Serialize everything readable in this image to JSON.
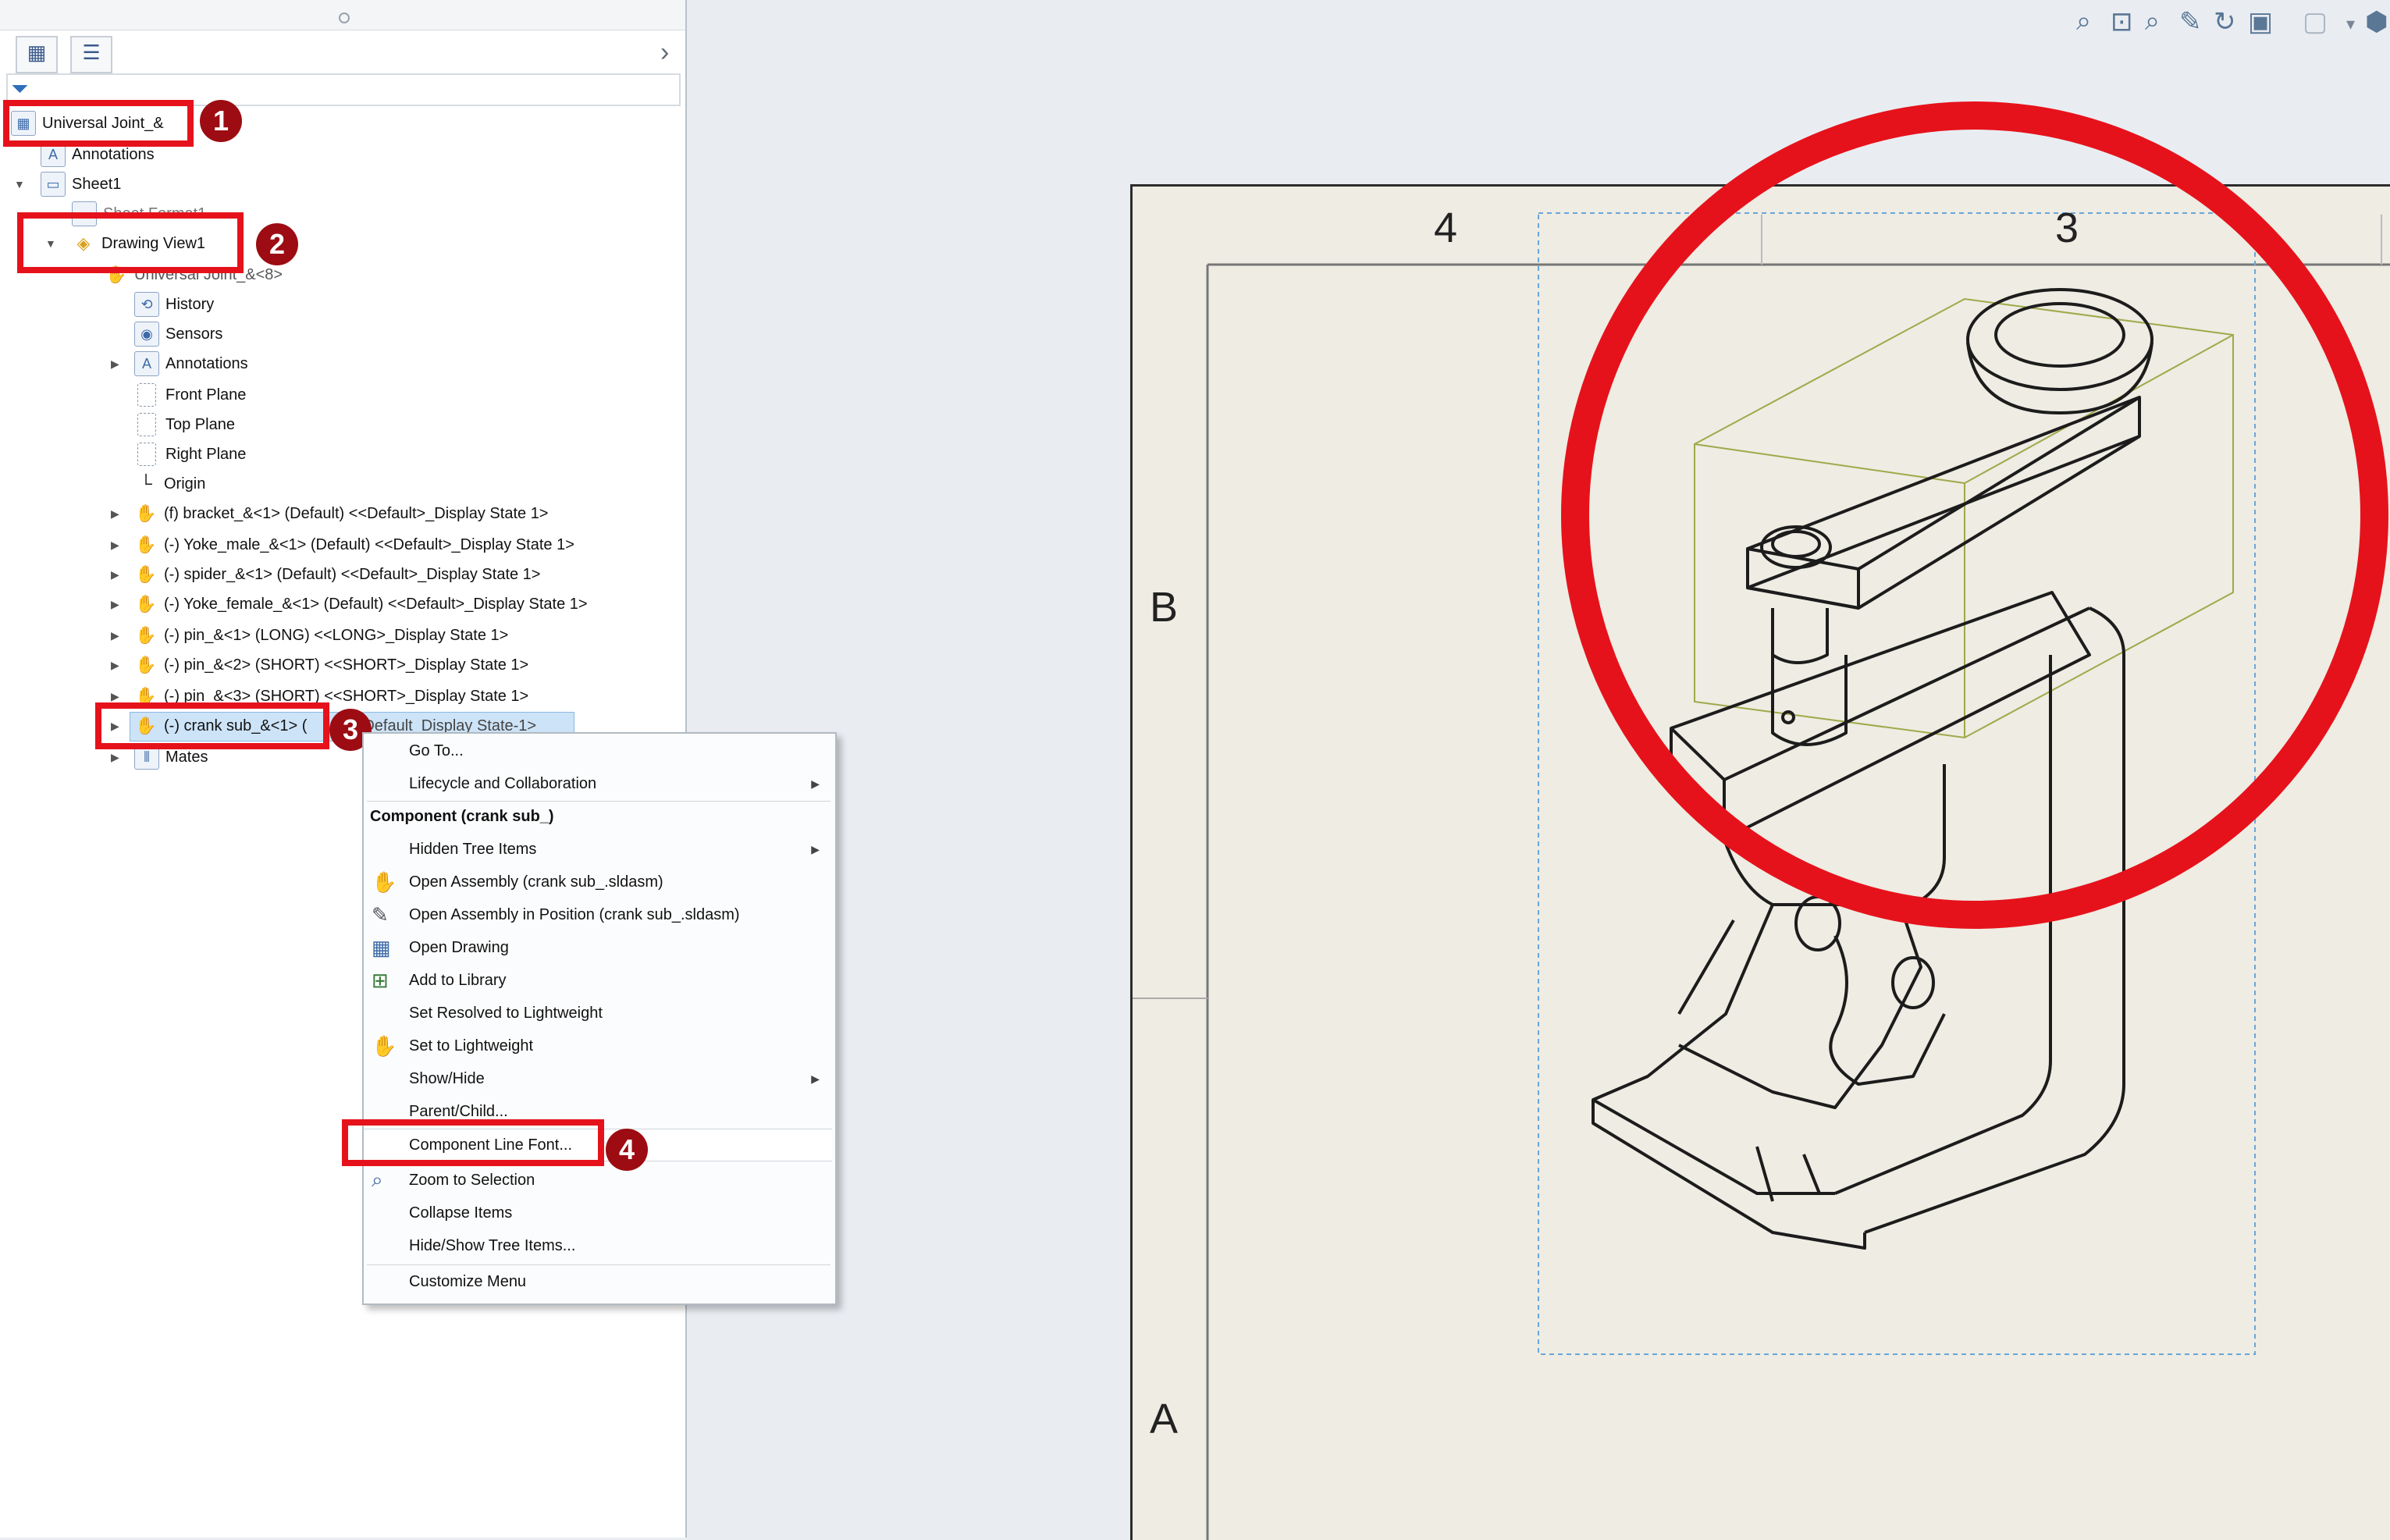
{
  "tree": {
    "root": "Universal Joint_&",
    "annotations": "Annotations",
    "sheet": "Sheet1",
    "sheet_format": "Sheet Format1",
    "view": "Drawing View1",
    "model": "Universal Joint_&<8>",
    "history": "History",
    "sensors": "Sensors",
    "annotations2": "Annotations",
    "front_plane": "Front Plane",
    "top_plane": "Top Plane",
    "right_plane": "Right Plane",
    "origin": "Origin",
    "components": [
      "(f) bracket_&<1> (Default) <<Default>_Display State 1>",
      "(-) Yoke_male_&<1> (Default) <<Default>_Display State 1>",
      "(-) spider_&<1> (Default) <<Default>_Display State 1>",
      "(-) Yoke_female_&<1> (Default) <<Default>_Display State 1>",
      "(-) pin_&<1> (LONG) <<LONG>_Display State 1>",
      "(-) pin_&<2> (SHORT) <<SHORT>_Display State 1>",
      "(-) pin_&<3> (SHORT) <<SHORT>_Display State 1>"
    ],
    "selected": "(-) crank sub_&<1> (Default) <Default_Display State-1>",
    "selected_short": "(-) crank sub_&<1> (",
    "selected_rest": ") <Default_Display State-1>",
    "mates": "Mates"
  },
  "menu": {
    "goto": "Go To...",
    "lifecycle": "Lifecycle and Collaboration",
    "header": "Component (crank sub_)",
    "hidden": "Hidden Tree Items",
    "open_asm": "Open Assembly (crank sub_.sldasm)",
    "open_asm_pos": "Open Assembly in Position (crank sub_.sldasm)",
    "open_drawing": "Open Drawing",
    "add_library": "Add to Library",
    "set_resolved": "Set Resolved to Lightweight",
    "set_light": "Set to Lightweight",
    "show_hide": "Show/Hide",
    "parent_child": "Parent/Child...",
    "line_font": "Component Line Font...",
    "zoom_sel": "Zoom to Selection",
    "collapse": "Collapse Items",
    "hide_show_tree": "Hide/Show Tree Items...",
    "customize": "Customize Menu"
  },
  "badges": [
    "1",
    "2",
    "3",
    "4"
  ],
  "sheet_zones": {
    "col4": "4",
    "col3": "3",
    "rowB": "B",
    "rowA": "A"
  },
  "colors": {
    "highlight": "#e6121b",
    "badge": "#9c0c12",
    "selection": "#cde3f7"
  },
  "icons": [
    "feature-manager-icon",
    "property-manager-icon",
    "filter-icon",
    "zoom-to-fit-icon",
    "zoom-area-icon",
    "previous-view-icon",
    "rebuild-icon",
    "display-style-icon"
  ]
}
